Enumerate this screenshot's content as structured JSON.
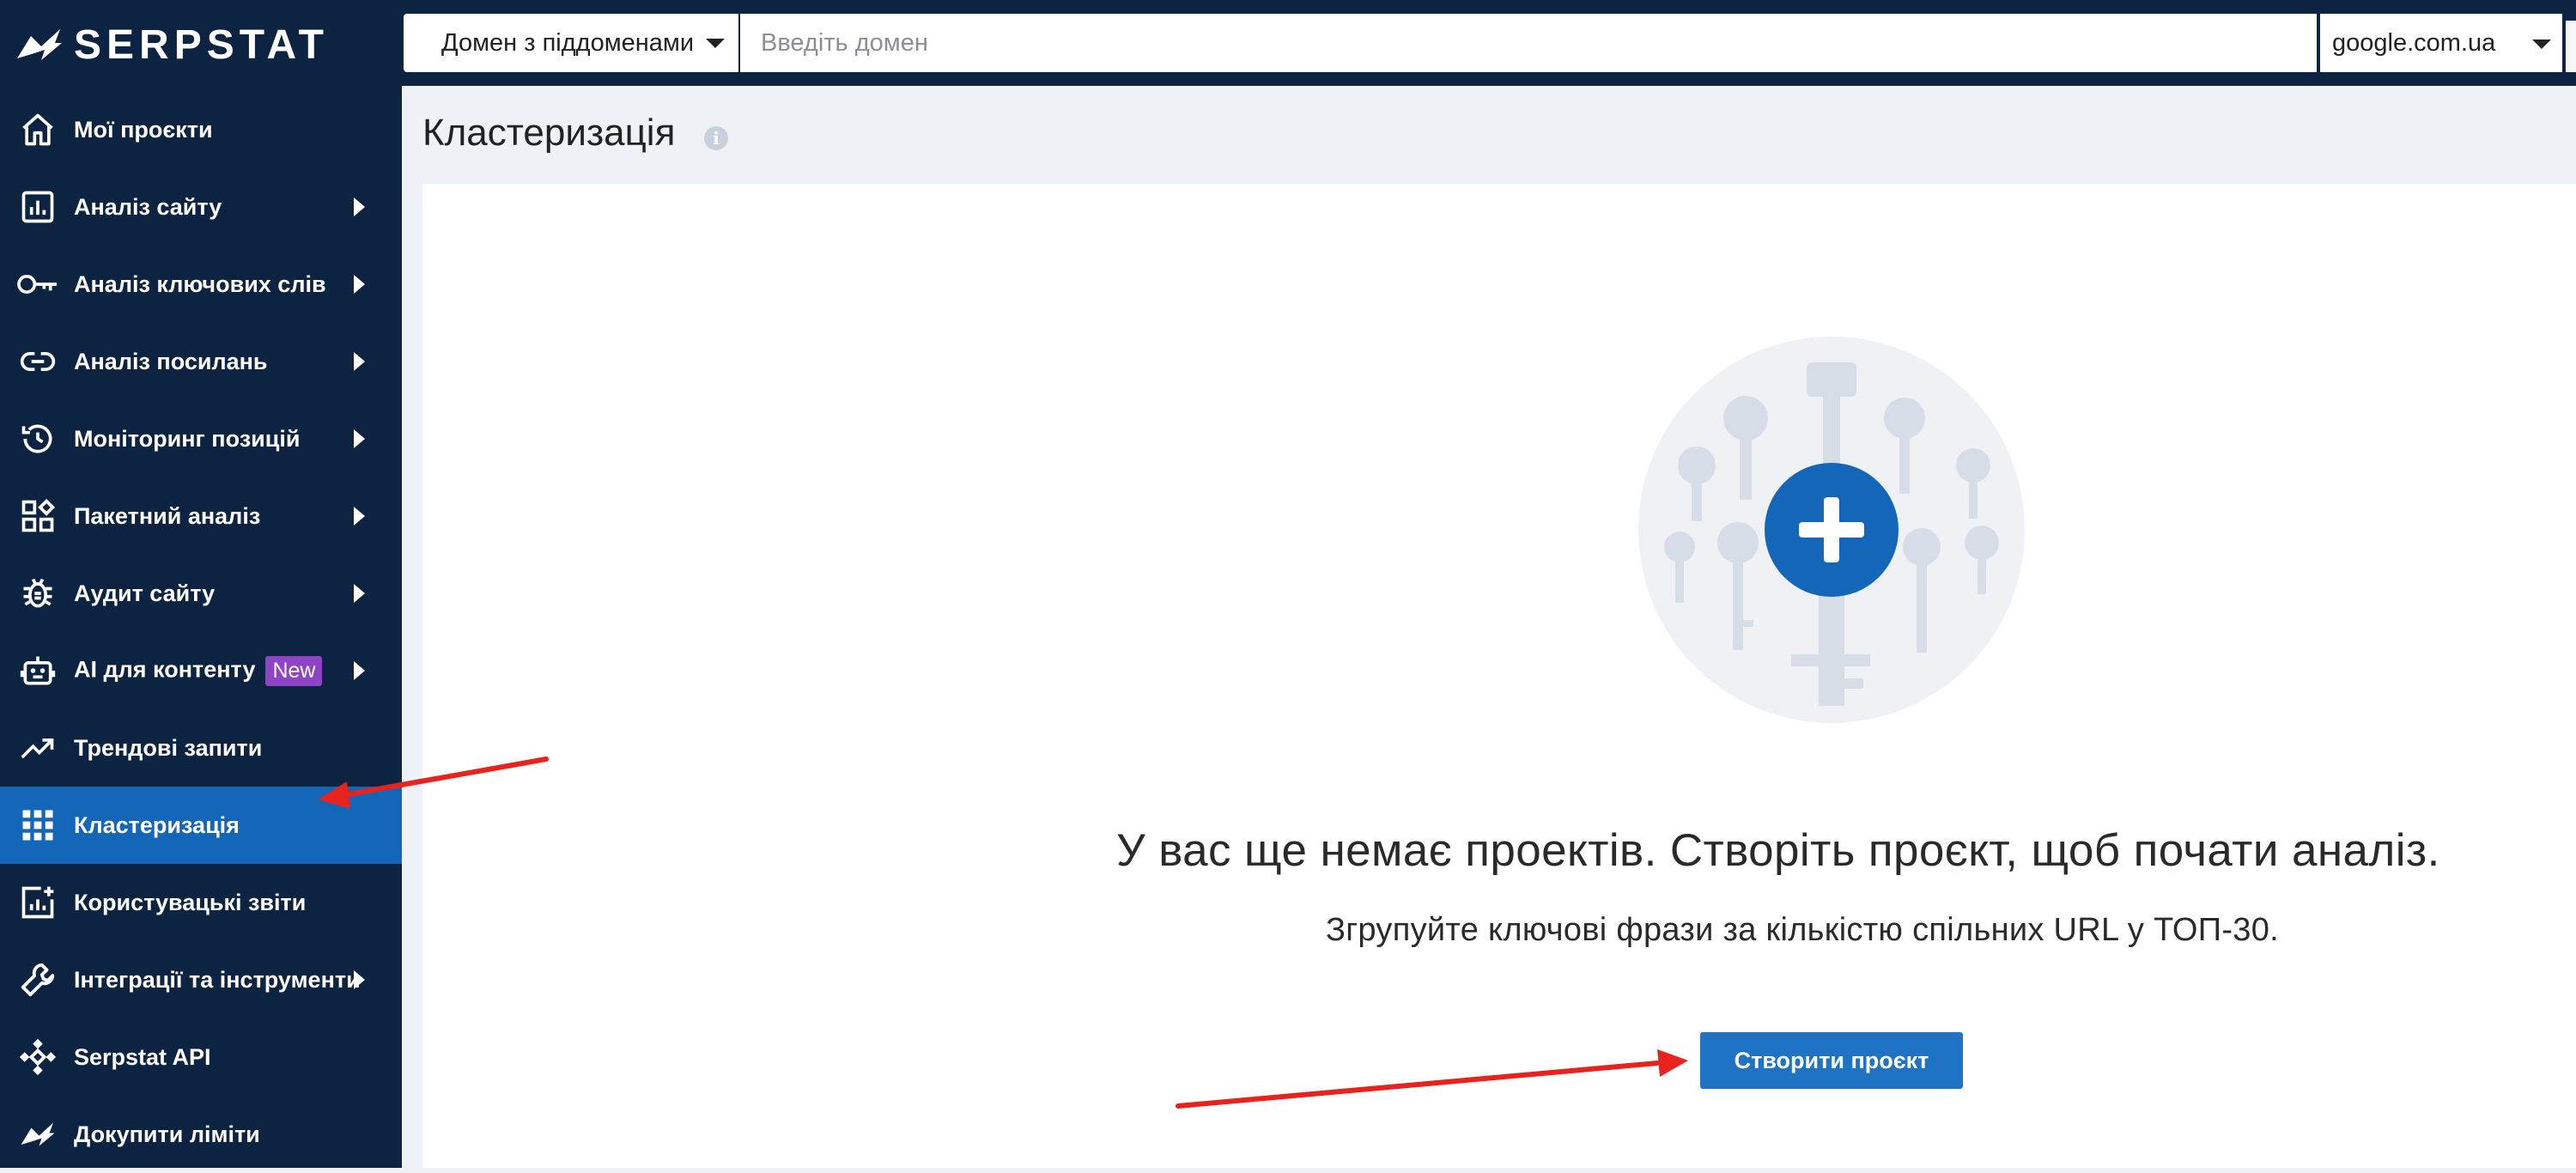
{
  "brand": {
    "name": "SERPSTAT"
  },
  "sidebar": {
    "items": [
      {
        "label": "Мої проєкти",
        "icon": "home-icon",
        "has_submenu": false
      },
      {
        "label": "Аналіз сайту",
        "icon": "chart-bars-icon",
        "has_submenu": true
      },
      {
        "label": "Аналіз ключових слів",
        "icon": "key-icon",
        "has_submenu": true
      },
      {
        "label": "Аналіз посилань",
        "icon": "link-icon",
        "has_submenu": true
      },
      {
        "label": "Моніторинг позицій",
        "icon": "history-icon",
        "has_submenu": true
      },
      {
        "label": "Пакетний аналіз",
        "icon": "widgets-icon",
        "has_submenu": true
      },
      {
        "label": "Аудит сайту",
        "icon": "bug-icon",
        "has_submenu": true
      },
      {
        "label": "AI для контенту",
        "icon": "robot-icon",
        "has_submenu": true,
        "badge": "New"
      },
      {
        "label": "Трендові запити",
        "icon": "trending-up-icon",
        "has_submenu": false
      },
      {
        "label": "Кластеризація",
        "icon": "grid-dots-icon",
        "has_submenu": false,
        "active": true
      },
      {
        "label": "Користувацькі звіти",
        "icon": "chart-plus-icon",
        "has_submenu": false
      },
      {
        "label": "Інтеграції та інструменти",
        "icon": "wrench-icon",
        "has_submenu": true
      },
      {
        "label": "Serpstat API",
        "icon": "api-icon",
        "has_submenu": false
      },
      {
        "label": "Докупити ліміти",
        "icon": "logo-small-icon",
        "has_submenu": false
      }
    ]
  },
  "search": {
    "scope_label": "Домен з піддоменами",
    "placeholder": "Введіть домен",
    "value": "",
    "engine": "google.com.ua"
  },
  "page": {
    "title": "Кластеризація",
    "empty_title": "У вас ще немає проектів. Створіть проєкт, щоб почати аналіз.",
    "empty_subtitle": "Згрупуйте ключові фрази за кількістю спільних URL у ТОП-30.",
    "create_button": "Створити проєкт"
  },
  "colors": {
    "sidebar_bg": "#0c2442",
    "active_item": "#1466b8",
    "primary_button": "#1e73c4",
    "badge_new": "#8e44c4",
    "annotation_arrow": "#e8231e"
  }
}
